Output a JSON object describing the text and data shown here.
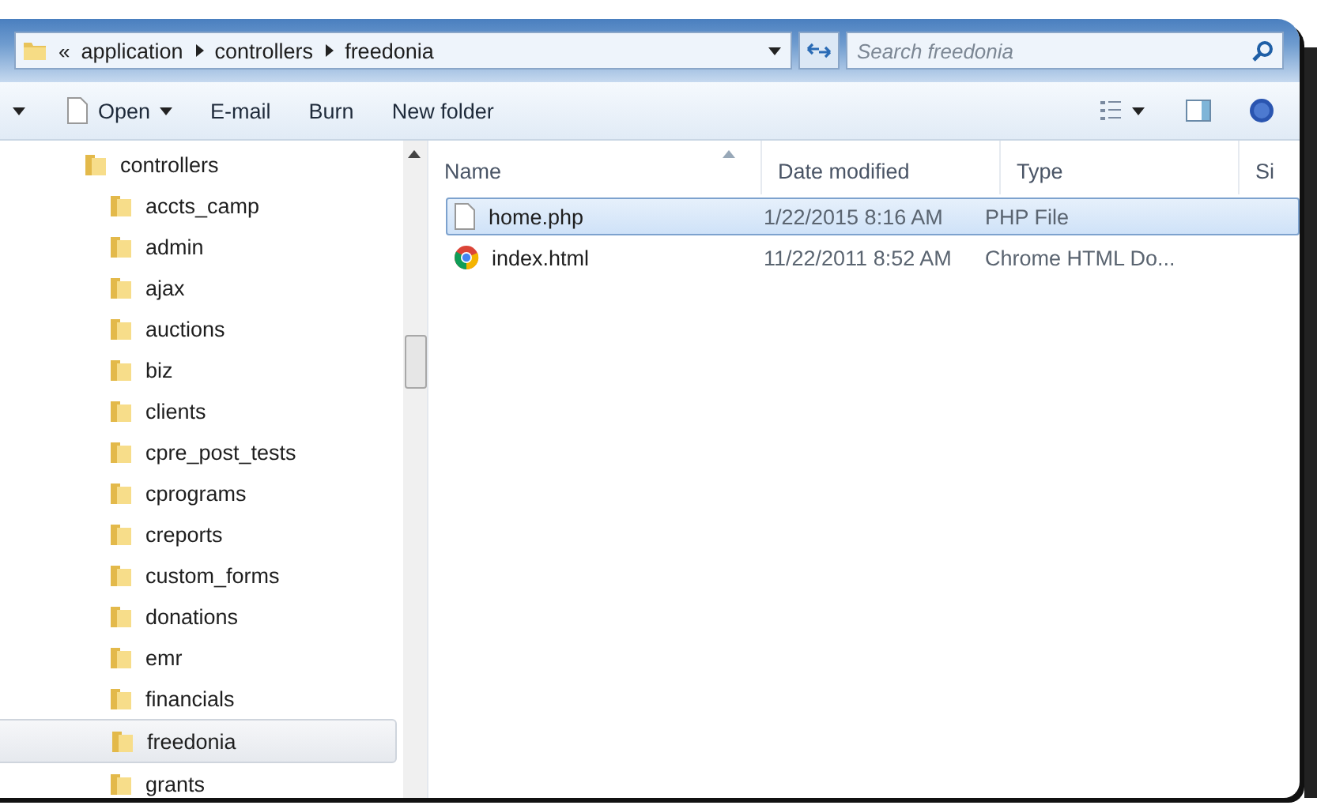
{
  "address_bar": {
    "overflow": "«",
    "crumbs": [
      "application",
      "controllers",
      "freedonia"
    ]
  },
  "search": {
    "placeholder": "Search freedonia"
  },
  "toolbar": {
    "buttons": [
      {
        "label": "Open",
        "kind": "menu"
      },
      {
        "label": "E-mail",
        "kind": "plain"
      },
      {
        "label": "Burn",
        "kind": "plain"
      },
      {
        "label": "New folder",
        "kind": "plain"
      }
    ]
  },
  "sidebar": {
    "items": [
      {
        "label": "controllers",
        "selected": false,
        "children": [
          {
            "label": "accts_camp",
            "selected": false
          },
          {
            "label": "admin",
            "selected": false
          },
          {
            "label": "ajax",
            "selected": false
          },
          {
            "label": "auctions",
            "selected": false
          },
          {
            "label": "biz",
            "selected": false
          },
          {
            "label": "clients",
            "selected": false
          },
          {
            "label": "cpre_post_tests",
            "selected": false
          },
          {
            "label": "cprograms",
            "selected": false
          },
          {
            "label": "creports",
            "selected": false
          },
          {
            "label": "custom_forms",
            "selected": false
          },
          {
            "label": "donations",
            "selected": false
          },
          {
            "label": "emr",
            "selected": false
          },
          {
            "label": "financials",
            "selected": false
          },
          {
            "label": "freedonia",
            "selected": true
          },
          {
            "label": "grants",
            "selected": false
          }
        ]
      }
    ]
  },
  "table": {
    "columns": [
      "Name",
      "Date modified",
      "Type",
      "Si"
    ],
    "rows": [
      {
        "kind": "document",
        "name": "home.php",
        "date": "1/22/2015 8:16 AM",
        "type": "PHP File",
        "selected": true
      },
      {
        "kind": "browser",
        "name": "index.html",
        "date": "11/22/2011 8:52 AM",
        "type": "Chrome HTML Do...",
        "selected": false
      }
    ]
  }
}
